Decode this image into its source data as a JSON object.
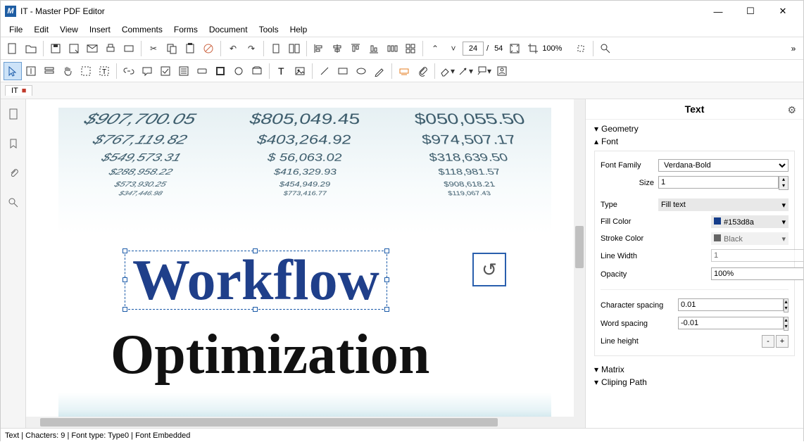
{
  "app": {
    "icon_letter": "M",
    "title": "IT - Master PDF Editor"
  },
  "menubar": [
    "File",
    "Edit",
    "View",
    "Insert",
    "Comments",
    "Forms",
    "Document",
    "Tools",
    "Help"
  ],
  "toolbar": {
    "page_current": "24",
    "page_total": "54",
    "zoom": "100%"
  },
  "tab": {
    "name": "IT"
  },
  "document": {
    "bg_numbers": [
      [
        "$907,700.05",
        "$805,049.45",
        "$050,055.50"
      ],
      [
        "$767,119.82",
        "$403,264.92",
        "$974,507.17"
      ],
      [
        "$549,573.31",
        "$ 56,063.02",
        "$318,639.50"
      ],
      [
        "$288,958.22",
        "$416,329.93",
        "$118,981.57"
      ],
      [
        "$573,930.25",
        "$454,949.29",
        "$908,618.21"
      ],
      [
        "$347,446.98",
        "$773,416.77",
        "$119,067.43"
      ]
    ],
    "selected_text": "Workflow",
    "second_text": "Optimization",
    "rotate_glyph": "↺"
  },
  "inspector": {
    "title": "Text",
    "sections": {
      "geometry": "Geometry",
      "font": "Font",
      "matrix": "Matrix",
      "clip": "Cliping Path"
    },
    "font": {
      "family_label": "Font Family",
      "family_value": "Verdana-Bold",
      "size_label": "Size",
      "size_value": "1",
      "type_label": "Type",
      "type_value": "Fill text",
      "fill_label": "Fill Color",
      "fill_value": "#153d8a",
      "fill_swatch": "#153d8a",
      "stroke_label": "Stroke Color",
      "stroke_value": "Black",
      "stroke_swatch": "#000000",
      "lw_label": "Line Width",
      "lw_value": "1",
      "opacity_label": "Opacity",
      "opacity_value": "100%",
      "charsp_label": "Character spacing",
      "charsp_value": "0.01",
      "wordsp_label": "Word spacing",
      "wordsp_value": "-0.01",
      "lh_label": "Line height",
      "lh_minus": "-",
      "lh_plus": "+"
    }
  },
  "status": "Text | Chacters: 9 | Font type: Type0 | Font Embedded"
}
